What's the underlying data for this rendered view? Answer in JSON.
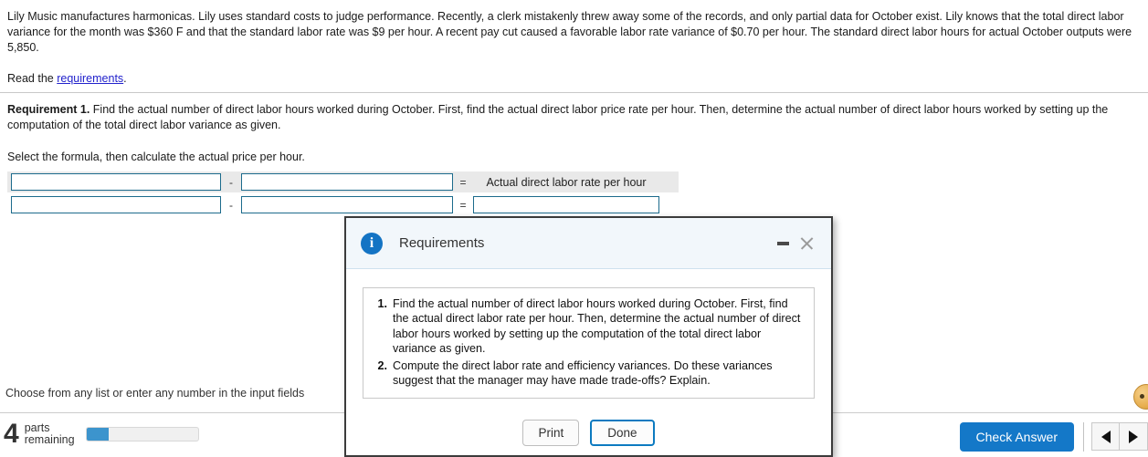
{
  "problem": {
    "statement": "Lily Music manufactures harmonicas. Lily uses standard costs to judge performance. Recently, a clerk mistakenly threw away some of the records, and only partial data for October exist. Lily knows that the total direct labor variance for the month was $360 F and that the standard labor rate was $9 per hour. A recent pay cut caused a favorable labor rate variance of $0.70 per hour. The standard direct labor hours for actual October outputs were 5,850.",
    "read_prefix": "Read the ",
    "read_link": "requirements",
    "read_suffix": "."
  },
  "requirement": {
    "label": "Requirement 1.",
    "text": " Find the actual number of direct labor hours worked during October. First, find the actual direct labor price rate per hour. Then, determine the actual number of direct labor hours worked by setting up the computation of the total direct labor variance as given.",
    "instruction": "Select the formula, then calculate the actual price per hour."
  },
  "formula": {
    "operators": {
      "minus": "-",
      "equals": "="
    },
    "rows": [
      {
        "term1": "",
        "term2": "",
        "result_label": "Actual direct labor rate per hour",
        "result_is_input": false,
        "result_value": "",
        "shaded": true
      },
      {
        "term1": "",
        "term2": "",
        "result_label": "",
        "result_is_input": true,
        "result_value": "",
        "shaded": false
      }
    ]
  },
  "dialog": {
    "icon": "info-icon",
    "title": "Requirements",
    "minimize_title": "Minimize",
    "close_title": "Close",
    "items": [
      {
        "num": "1.",
        "text": "Find the actual number of direct labor hours worked during October. First, find the actual direct labor rate per hour. Then, determine the actual number of direct labor hours worked by setting up the computation of the total direct labor variance as given."
      },
      {
        "num": "2.",
        "text": "Compute the direct labor rate and efficiency variances. Do these variances suggest that the manager may have made trade-offs? Explain."
      }
    ],
    "print_label": "Print",
    "done_label": "Done"
  },
  "bottom": {
    "choose_text": "Choose from any list or enter any number in the input fields"
  },
  "footer": {
    "parts_count": "4",
    "parts_word": "parts",
    "remaining_word": "remaining",
    "progress_percent": 20,
    "check_answer_label": "Check Answer",
    "prev_label": "Previous",
    "next_label": "Next"
  },
  "colors": {
    "accent_blue": "#1478c8",
    "progress_blue": "#3c94cd",
    "input_border": "#1c6b8c",
    "link_blue": "#2222cc",
    "dialog_header": "#f2f7fb"
  }
}
